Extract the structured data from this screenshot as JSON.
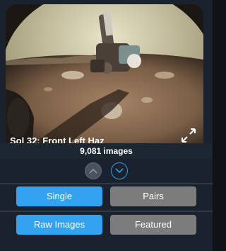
{
  "viewer": {
    "caption": "Sol 32: Front Left Haz",
    "expand_icon": "expand-icon"
  },
  "image_count": "9,081 images",
  "nav": {
    "up_icon": "chevron-up-icon",
    "down_icon": "chevron-down-icon"
  },
  "view_mode": {
    "options": [
      "Single",
      "Pairs"
    ],
    "selected": "Single"
  },
  "image_type": {
    "options": [
      "Raw Images",
      "Featured"
    ],
    "selected": "Raw Images"
  },
  "colors": {
    "accent": "#31a3f0",
    "inactive": "#7c7c7c",
    "background": "#1a232d"
  }
}
